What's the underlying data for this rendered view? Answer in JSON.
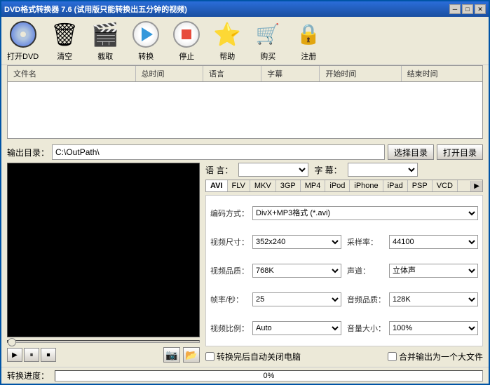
{
  "window": {
    "title": "DVD格式转换器 7.6 (试用版只能转换出五分钟的视频)",
    "min_btn": "─",
    "max_btn": "□",
    "close_btn": "✕"
  },
  "toolbar": {
    "items": [
      {
        "id": "open-dvd",
        "label": "打开DVD",
        "icon": "dvd"
      },
      {
        "id": "clear",
        "label": "清空",
        "icon": "clear"
      },
      {
        "id": "capture",
        "label": "截取",
        "icon": "film"
      },
      {
        "id": "convert",
        "label": "转换",
        "icon": "play"
      },
      {
        "id": "stop",
        "label": "停止",
        "icon": "stop"
      },
      {
        "id": "help",
        "label": "帮助",
        "icon": "star"
      },
      {
        "id": "buy",
        "label": "购买",
        "icon": "cart"
      },
      {
        "id": "register",
        "label": "注册",
        "icon": "lock"
      }
    ]
  },
  "file_table": {
    "headers": [
      "文件名",
      "总时间",
      "语言",
      "字幕",
      "开始时间",
      "结束时间"
    ]
  },
  "output": {
    "label": "输出目录：",
    "path": "C:\\OutPath\\",
    "select_btn": "选择目录",
    "open_btn": "打开目录"
  },
  "language": {
    "label": "语  言：",
    "value": ""
  },
  "subtitle": {
    "label": "字 幕：",
    "value": ""
  },
  "format_tabs": [
    {
      "id": "avi",
      "label": "AVI",
      "active": true
    },
    {
      "id": "flv",
      "label": "FLV",
      "active": false
    },
    {
      "id": "mkv",
      "label": "MKV",
      "active": false
    },
    {
      "id": "3gp",
      "label": "3GP",
      "active": false
    },
    {
      "id": "mp4",
      "label": "MP4",
      "active": false
    },
    {
      "id": "ipod",
      "label": "iPod",
      "active": false
    },
    {
      "id": "iphone",
      "label": "iPhone",
      "active": false
    },
    {
      "id": "ipad",
      "label": "iPad",
      "active": false
    },
    {
      "id": "psp",
      "label": "PSP",
      "active": false
    },
    {
      "id": "vcd",
      "label": "VCD",
      "active": false
    }
  ],
  "settings": {
    "codec": {
      "label": "编码方式：",
      "value": "DivX+MP3格式 (*.avi)"
    },
    "sample_rate": {
      "label": "采样率：",
      "value": "44100"
    },
    "video_size": {
      "label": "视频尺寸：",
      "value": "352x240"
    },
    "audio_channel": {
      "label": "声道：",
      "value": "立体声"
    },
    "video_quality": {
      "label": "视频品质：",
      "value": "768K"
    },
    "audio_quality": {
      "label": "音频品质：",
      "value": "128K"
    },
    "frame_rate": {
      "label": "帧率/秒：",
      "value": "25"
    },
    "volume": {
      "label": "音量大小：",
      "value": "100%"
    },
    "aspect_ratio": {
      "label": "视频比例：",
      "value": "Auto"
    }
  },
  "checkboxes": {
    "auto_shutdown": {
      "label": "转换完后自动关闭电脑",
      "checked": false
    },
    "merge_output": {
      "label": "合并输出为一个大文件",
      "checked": false
    }
  },
  "progress": {
    "label": "转换进度：",
    "percent": "0%",
    "value": 0
  },
  "controls": {
    "play": "▶",
    "pause": "⏸",
    "stop": "⏹",
    "camera": "📷",
    "folder": "📂"
  }
}
